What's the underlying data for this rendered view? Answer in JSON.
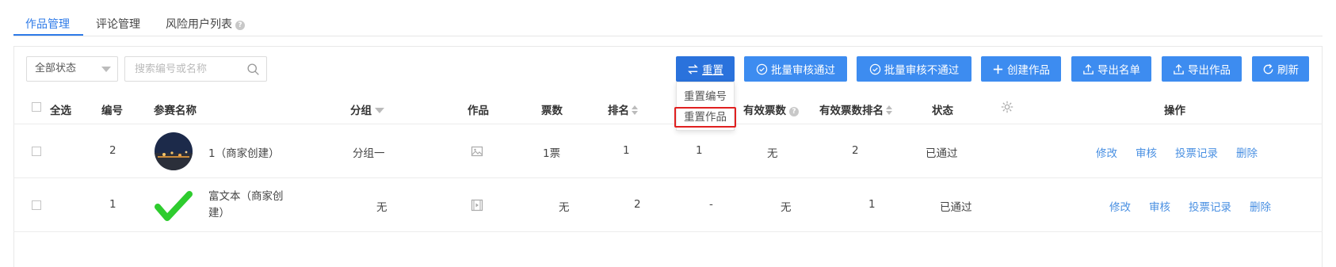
{
  "tabs": [
    {
      "label": "作品管理",
      "active": true
    },
    {
      "label": "评论管理",
      "active": false
    },
    {
      "label": "风险用户列表",
      "active": false,
      "help": "?"
    }
  ],
  "toolbar": {
    "status_select": "全部状态",
    "search_placeholder": "搜索编号或名称",
    "buttons": {
      "reset": "重置",
      "batch_approve": "批量审核通过",
      "batch_reject": "批量审核不通过",
      "create": "创建作品",
      "export_list": "导出名单",
      "export_works": "导出作品",
      "refresh": "刷新"
    },
    "reset_menu": [
      "重置编号",
      "重置作品"
    ]
  },
  "table": {
    "headers": {
      "select_all": "全选",
      "id": "编号",
      "name": "参赛名称",
      "group": "分组",
      "work": "作品",
      "votes": "票数",
      "rank": "排名",
      "valid_votes": "有效票数",
      "valid_rank": "有效票数排名",
      "status": "状态",
      "actions": "操作"
    },
    "rows": [
      {
        "id": "2",
        "name": "1（商家创建）",
        "group": "分组一",
        "work_icon": "image-icon",
        "votes": "1票",
        "rank": "1",
        "col_rank2": "1",
        "valid_votes": "无",
        "valid_rank": "2",
        "status": "已通过",
        "actions": [
          "修改",
          "审核",
          "投票记录",
          "删除"
        ]
      },
      {
        "id": "1",
        "name": "富文本（商家创建）",
        "group": "无",
        "work_icon": "video-icon",
        "votes": "无",
        "rank": "2",
        "col_rank2": "-",
        "valid_votes": "无",
        "valid_rank": "1",
        "status": "已通过",
        "actions": [
          "修改",
          "审核",
          "投票记录",
          "删除"
        ]
      }
    ]
  },
  "colors": {
    "primary": "#3d8cf0",
    "reset_active": "#2a72dc",
    "link": "#4a90e2",
    "highlight_border": "#e02020",
    "check_green": "#2ecc2e"
  }
}
